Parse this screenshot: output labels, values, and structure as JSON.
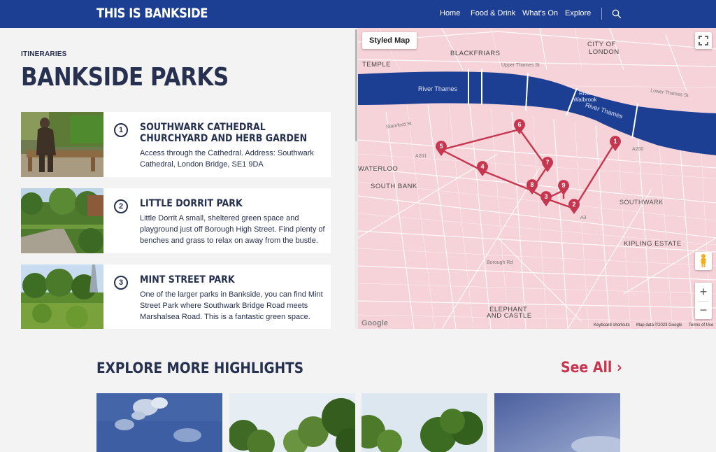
{
  "header": {
    "logo": "THIS IS BANKSIDE",
    "nav": [
      "Home",
      "Food & Drink",
      "What's On",
      "Explore"
    ],
    "search_icon": "search-icon"
  },
  "page": {
    "eyebrow": "ITINERARIES",
    "title": "BANKSIDE PARKS"
  },
  "cards": [
    {
      "number": "1",
      "title": "SOUTHWARK CATHEDRAL CHURCHYARD AND HERB GARDEN",
      "description": "Access through the Cathedral. Address: Southwark Cathedral, London Bridge, SE1 9DA"
    },
    {
      "number": "2",
      "title": "LITTLE DORRIT PARK",
      "description": "Little Dorrit A small, sheltered green space and playground just off Borough High Street. Find plenty of benches and grass to relax on away from the bustle."
    },
    {
      "number": "3",
      "title": "MINT STREET PARK",
      "description": "One of the larger parks in Bankside, you can find Mint Street Park where Southwark Bridge Road meets Marshalsea Road. This is a fantastic green space."
    }
  ],
  "map": {
    "styled_map_button": "Styled Map",
    "labels": {
      "blackfriars": "BLACKFRIARS",
      "city_of_london_1": "CITY OF",
      "city_of_london_2": "LONDON",
      "temple": "TEMPLE",
      "waterloo": "WATERLOO",
      "south_bank": "SOUTH BANK",
      "southwark": "SOUTHWARK",
      "kipling_estate": "KIPLING ESTATE",
      "elephant_1": "ELEPHANT",
      "elephant_2": "AND CASTLE",
      "river_thames_1": "River Thames",
      "river_thames_2": "River Thames",
      "river_walbrook_1": "River",
      "river_walbrook_2": "Walbrook",
      "upper_thames_st": "Upper Thames St",
      "lower_thames_st": "Lower Thames St",
      "a200": "A200",
      "a201": "A201",
      "a3": "A3",
      "borough_rd": "Borough Rd",
      "stamford_st": "Stamford St"
    },
    "markers": [
      "1",
      "2",
      "3",
      "4",
      "5",
      "6",
      "7",
      "8",
      "9"
    ],
    "google_logo": "Google",
    "attribution": {
      "shortcuts": "Keyboard shortcuts",
      "data": "Map data ©2023 Google",
      "terms": "Terms of Use"
    },
    "zoom_in": "+",
    "zoom_out": "−",
    "route_color": "#c6364f",
    "water_color": "#1d3f93",
    "land_color": "#f6d3d9"
  },
  "explore": {
    "title": "EXPLORE MORE HIGHLIGHTS",
    "see_all": "See All ›"
  },
  "colors": {
    "brand_blue": "#1d3f93",
    "accent_red": "#c6364f",
    "text_navy": "#26304f"
  }
}
